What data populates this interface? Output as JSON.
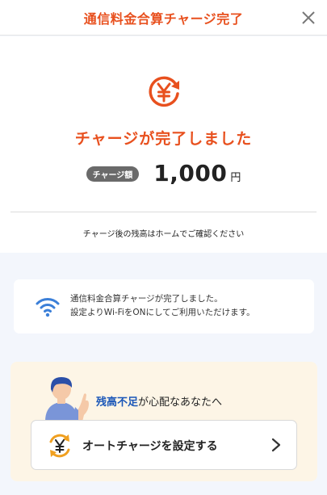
{
  "header": {
    "title": "通信料金合算チャージ完了",
    "close_icon": "close-icon"
  },
  "result": {
    "icon": "yen-refresh-icon",
    "title": "チャージが完了しました",
    "badge": "チャージ額",
    "amount": "1,000",
    "unit": "円",
    "note": "チャージ後の残高はホームでご確認ください"
  },
  "wifi_notice": {
    "icon": "wifi-icon",
    "line1": "通信料金合算チャージが完了しました。",
    "line2": "設定よりWi-FiをONにしてご利用いただけます。"
  },
  "promo": {
    "title_emph": "残高不足",
    "title_rest": "が心配なあなたへ",
    "button_label": "オートチャージを設定する",
    "button_icon": "auto-charge-yen-icon"
  },
  "colors": {
    "accent": "#e8501e",
    "emphasis_blue": "#1a56b8",
    "promo_bg": "#fdf5e6",
    "page_bg": "#f3f6fc"
  }
}
